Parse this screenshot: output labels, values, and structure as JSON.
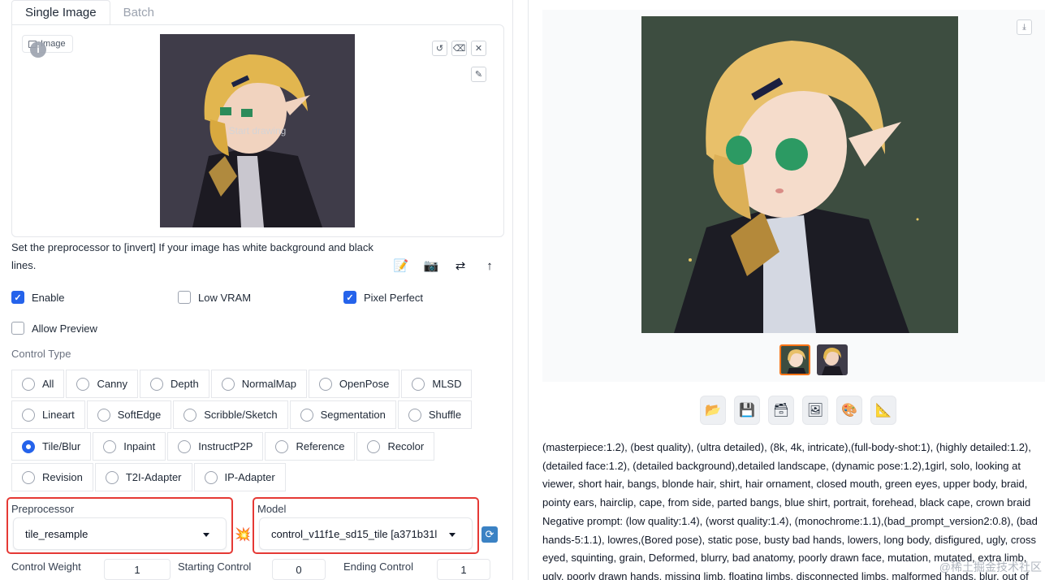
{
  "tabs": [
    "Single Image",
    "Batch"
  ],
  "image_panel": {
    "label": "Image",
    "canvas_hint": "Start drawing",
    "tool_icons": [
      "undo-icon",
      "eraser-icon",
      "close-icon",
      "brush-icon"
    ]
  },
  "hint_text": "Set the preprocessor to [invert] If your image has white background and black lines.",
  "action_icons": [
    "edit-icon",
    "camera-icon",
    "swap-icon",
    "upload-arrow-icon"
  ],
  "checkboxes": {
    "enable": {
      "label": "Enable",
      "checked": true
    },
    "low_vram": {
      "label": "Low VRAM",
      "checked": false
    },
    "pixel_perfect": {
      "label": "Pixel Perfect",
      "checked": true
    },
    "allow_preview": {
      "label": "Allow Preview",
      "checked": false
    }
  },
  "control_type": {
    "label": "Control Type",
    "rows": [
      [
        "All",
        "Canny",
        "Depth",
        "NormalMap",
        "OpenPose",
        "MLSD"
      ],
      [
        "Lineart",
        "SoftEdge",
        "Scribble/Sketch",
        "Segmentation",
        "Shuffle"
      ],
      [
        "Tile/Blur",
        "Inpaint",
        "InstructP2P",
        "Reference",
        "Recolor"
      ],
      [
        "Revision",
        "T2I-Adapter",
        "IP-Adapter"
      ]
    ],
    "selected": "Tile/Blur"
  },
  "preprocessor": {
    "label": "Preprocessor",
    "value": "tile_resample"
  },
  "model": {
    "label": "Model",
    "value": "control_v11f1e_sd15_tile [a371b31l"
  },
  "sliders": {
    "control_weight": {
      "label": "Control Weight",
      "value": "1"
    },
    "starting_control": {
      "label": "Starting Control",
      "value": "0"
    },
    "ending_control": {
      "label": "Ending Control",
      "value": "1"
    }
  },
  "output": {
    "toolbar_icons": [
      "folder-icon",
      "save-icon",
      "zip-icon",
      "image-icon",
      "palette-icon",
      "ruler-icon"
    ],
    "prompt_text": "(masterpiece:1.2), (best quality), (ultra detailed), (8k, 4k, intricate),(full-body-shot:1), (highly detailed:1.2), (detailed face:1.2), (detailed background),detailed landscape, (dynamic pose:1.2),1girl, solo, looking at viewer, short hair, bangs, blonde hair, shirt, hair ornament, closed mouth, green eyes, upper body, braid, pointy ears, hairclip, cape, from side, parted bangs, blue shirt, portrait, forehead, black cape, crown braid Negative prompt: (low quality:1.4), (worst quality:1.4), (monochrome:1.1),(bad_prompt_version2:0.8), (bad hands-5:1.1), lowres,(Bored pose), static pose, busty bad hands, lowers, long body, disfigured, ugly, cross eyed, squinting, grain, Deformed, blurry, bad anatomy, poorly drawn face, mutation, mutated, extra limb, ugly, poorly drawn hands, missing limb, floating limbs, disconnected limbs, malformed hands, blur, out of",
    "watermark": "@稀土掘金技术社区"
  },
  "colors": {
    "accent": "#2563eb",
    "highlight_border": "#e53935",
    "selected_thumb": "#f97316"
  }
}
